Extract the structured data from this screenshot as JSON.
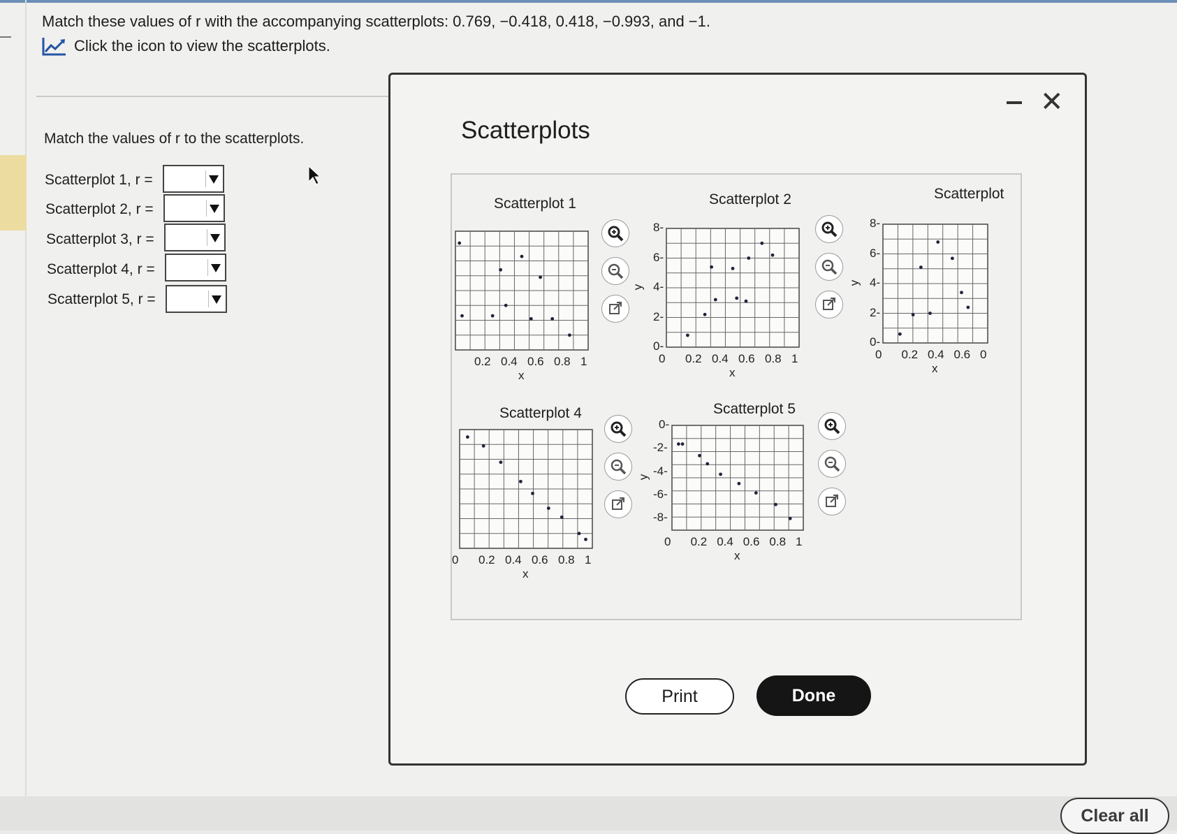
{
  "question": {
    "text": "Match these values of r with the accompanying scatterplots: 0.769, −0.418, 0.418, −0.993, and −1.",
    "hint": "Click the icon to view the scatterplots.",
    "hint_icon": "chart-line-icon"
  },
  "instruction": "Match the values of r to the scatterplots.",
  "rows": [
    {
      "label": "Scatterplot 1, r =",
      "value": ""
    },
    {
      "label": "Scatterplot 2, r =",
      "value": ""
    },
    {
      "label": "Scatterplot 3, r =",
      "value": ""
    },
    {
      "label": "Scatterplot 4, r =",
      "value": ""
    },
    {
      "label": "Scatterplot 5, r =",
      "value": ""
    }
  ],
  "modal": {
    "title": "Scatterplots",
    "print": "Print",
    "done": "Done",
    "minimize_icon": "minimize-icon",
    "close_icon": "close-icon"
  },
  "clear_all": "Clear all",
  "chart_data": [
    {
      "type": "scatter",
      "title": "Scatterplot 1",
      "xlabel": "x",
      "ylabel": "",
      "xticks": [
        "0.2",
        "0.4",
        "0.6",
        "0.8",
        "1"
      ],
      "yticks": [],
      "xlim": [
        0,
        1
      ],
      "ylim": [
        0,
        8
      ],
      "points": [
        [
          0.03,
          7.2
        ],
        [
          0.05,
          2.3
        ],
        [
          0.28,
          2.3
        ],
        [
          0.38,
          3.0
        ],
        [
          0.34,
          5.4
        ],
        [
          0.5,
          6.3
        ],
        [
          0.57,
          2.1
        ],
        [
          0.64,
          4.9
        ],
        [
          0.73,
          2.1
        ],
        [
          0.86,
          1.0
        ]
      ]
    },
    {
      "type": "scatter",
      "title": "Scatterplot 2",
      "xlabel": "x",
      "ylabel": "y",
      "xticks": [
        "0",
        "0.2",
        "0.4",
        "0.6",
        "0.8",
        "1"
      ],
      "yticks": [
        "0",
        "2",
        "4",
        "6",
        "8"
      ],
      "xlim": [
        0,
        1
      ],
      "ylim": [
        0,
        8
      ],
      "points": [
        [
          0.16,
          0.8
        ],
        [
          0.29,
          2.2
        ],
        [
          0.34,
          5.4
        ],
        [
          0.37,
          3.2
        ],
        [
          0.5,
          5.3
        ],
        [
          0.53,
          3.3
        ],
        [
          0.6,
          3.1
        ],
        [
          0.62,
          6.0
        ],
        [
          0.72,
          7.0
        ],
        [
          0.8,
          6.2
        ]
      ]
    },
    {
      "type": "scatter",
      "title": "Scatterplot",
      "xlabel": "x",
      "ylabel": "y",
      "xticks": [
        "0",
        "0.2",
        "0.4",
        "0.6",
        "0"
      ],
      "yticks": [
        "0",
        "2",
        "4",
        "6",
        "8"
      ],
      "xlim": [
        0,
        0.8
      ],
      "ylim": [
        0,
        8
      ],
      "points": [
        [
          0.13,
          0.6
        ],
        [
          0.23,
          1.9
        ],
        [
          0.29,
          5.1
        ],
        [
          0.36,
          2.0
        ],
        [
          0.42,
          6.8
        ],
        [
          0.53,
          5.7
        ],
        [
          0.6,
          3.4
        ],
        [
          0.65,
          2.4
        ]
      ]
    },
    {
      "type": "scatter",
      "title": "Scatterplot 4",
      "xlabel": "x",
      "ylabel": "",
      "xticks": [
        "0",
        "0.2",
        "0.4",
        "0.6",
        "0.8",
        "1"
      ],
      "yticks": [],
      "xlim": [
        0,
        1
      ],
      "ylim": [
        0,
        8
      ],
      "points": [
        [
          0.06,
          7.5
        ],
        [
          0.18,
          6.9
        ],
        [
          0.31,
          5.8
        ],
        [
          0.46,
          4.5
        ],
        [
          0.55,
          3.7
        ],
        [
          0.67,
          2.7
        ],
        [
          0.77,
          2.1
        ],
        [
          0.9,
          1.0
        ],
        [
          0.95,
          0.6
        ]
      ]
    },
    {
      "type": "scatter",
      "title": "Scatterplot 5",
      "xlabel": "x",
      "ylabel": "y",
      "xticks": [
        "0",
        "0.2",
        "0.4",
        "0.6",
        "0.8",
        "1"
      ],
      "yticks": [
        "0",
        "-2",
        "-4",
        "-6",
        "-8"
      ],
      "xlim": [
        0,
        1
      ],
      "ylim": [
        -9,
        0
      ],
      "points": [
        [
          0.05,
          -1.6
        ],
        [
          0.08,
          -1.6
        ],
        [
          0.21,
          -2.6
        ],
        [
          0.27,
          -3.3
        ],
        [
          0.37,
          -4.2
        ],
        [
          0.51,
          -5.0
        ],
        [
          0.64,
          -5.8
        ],
        [
          0.79,
          -6.8
        ],
        [
          0.9,
          -8.0
        ]
      ]
    }
  ]
}
